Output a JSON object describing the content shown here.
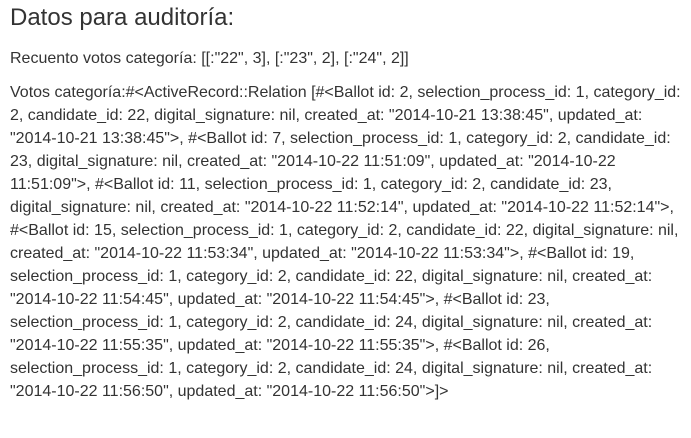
{
  "heading": "Datos para auditoría:",
  "count_line": "Recuento votos categoría: [[:\"22\", 3], [:\"23\", 2], [:\"24\", 2]]",
  "votes_line": "Votos categoría:#<ActiveRecord::Relation [#<Ballot id: 2, selection_process_id: 1, category_id: 2, candidate_id: 22, digital_signature: nil, created_at: \"2014-10-21 13:38:45\", updated_at: \"2014-10-21 13:38:45\">, #<Ballot id: 7, selection_process_id: 1, category_id: 2, candidate_id: 23, digital_signature: nil, created_at: \"2014-10-22 11:51:09\", updated_at: \"2014-10-22 11:51:09\">, #<Ballot id: 11, selection_process_id: 1, category_id: 2, candidate_id: 23, digital_signature: nil, created_at: \"2014-10-22 11:52:14\", updated_at: \"2014-10-22 11:52:14\">, #<Ballot id: 15, selection_process_id: 1, category_id: 2, candidate_id: 22, digital_signature: nil, created_at: \"2014-10-22 11:53:34\", updated_at: \"2014-10-22 11:53:34\">, #<Ballot id: 19, selection_process_id: 1, category_id: 2, candidate_id: 22, digital_signature: nil, created_at: \"2014-10-22 11:54:45\", updated_at: \"2014-10-22 11:54:45\">, #<Ballot id: 23, selection_process_id: 1, category_id: 2, candidate_id: 24, digital_signature: nil, created_at: \"2014-10-22 11:55:35\", updated_at: \"2014-10-22 11:55:35\">, #<Ballot id: 26, selection_process_id: 1, category_id: 2, candidate_id: 24, digital_signature: nil, created_at: \"2014-10-22 11:56:50\", updated_at: \"2014-10-22 11:56:50\">]>"
}
